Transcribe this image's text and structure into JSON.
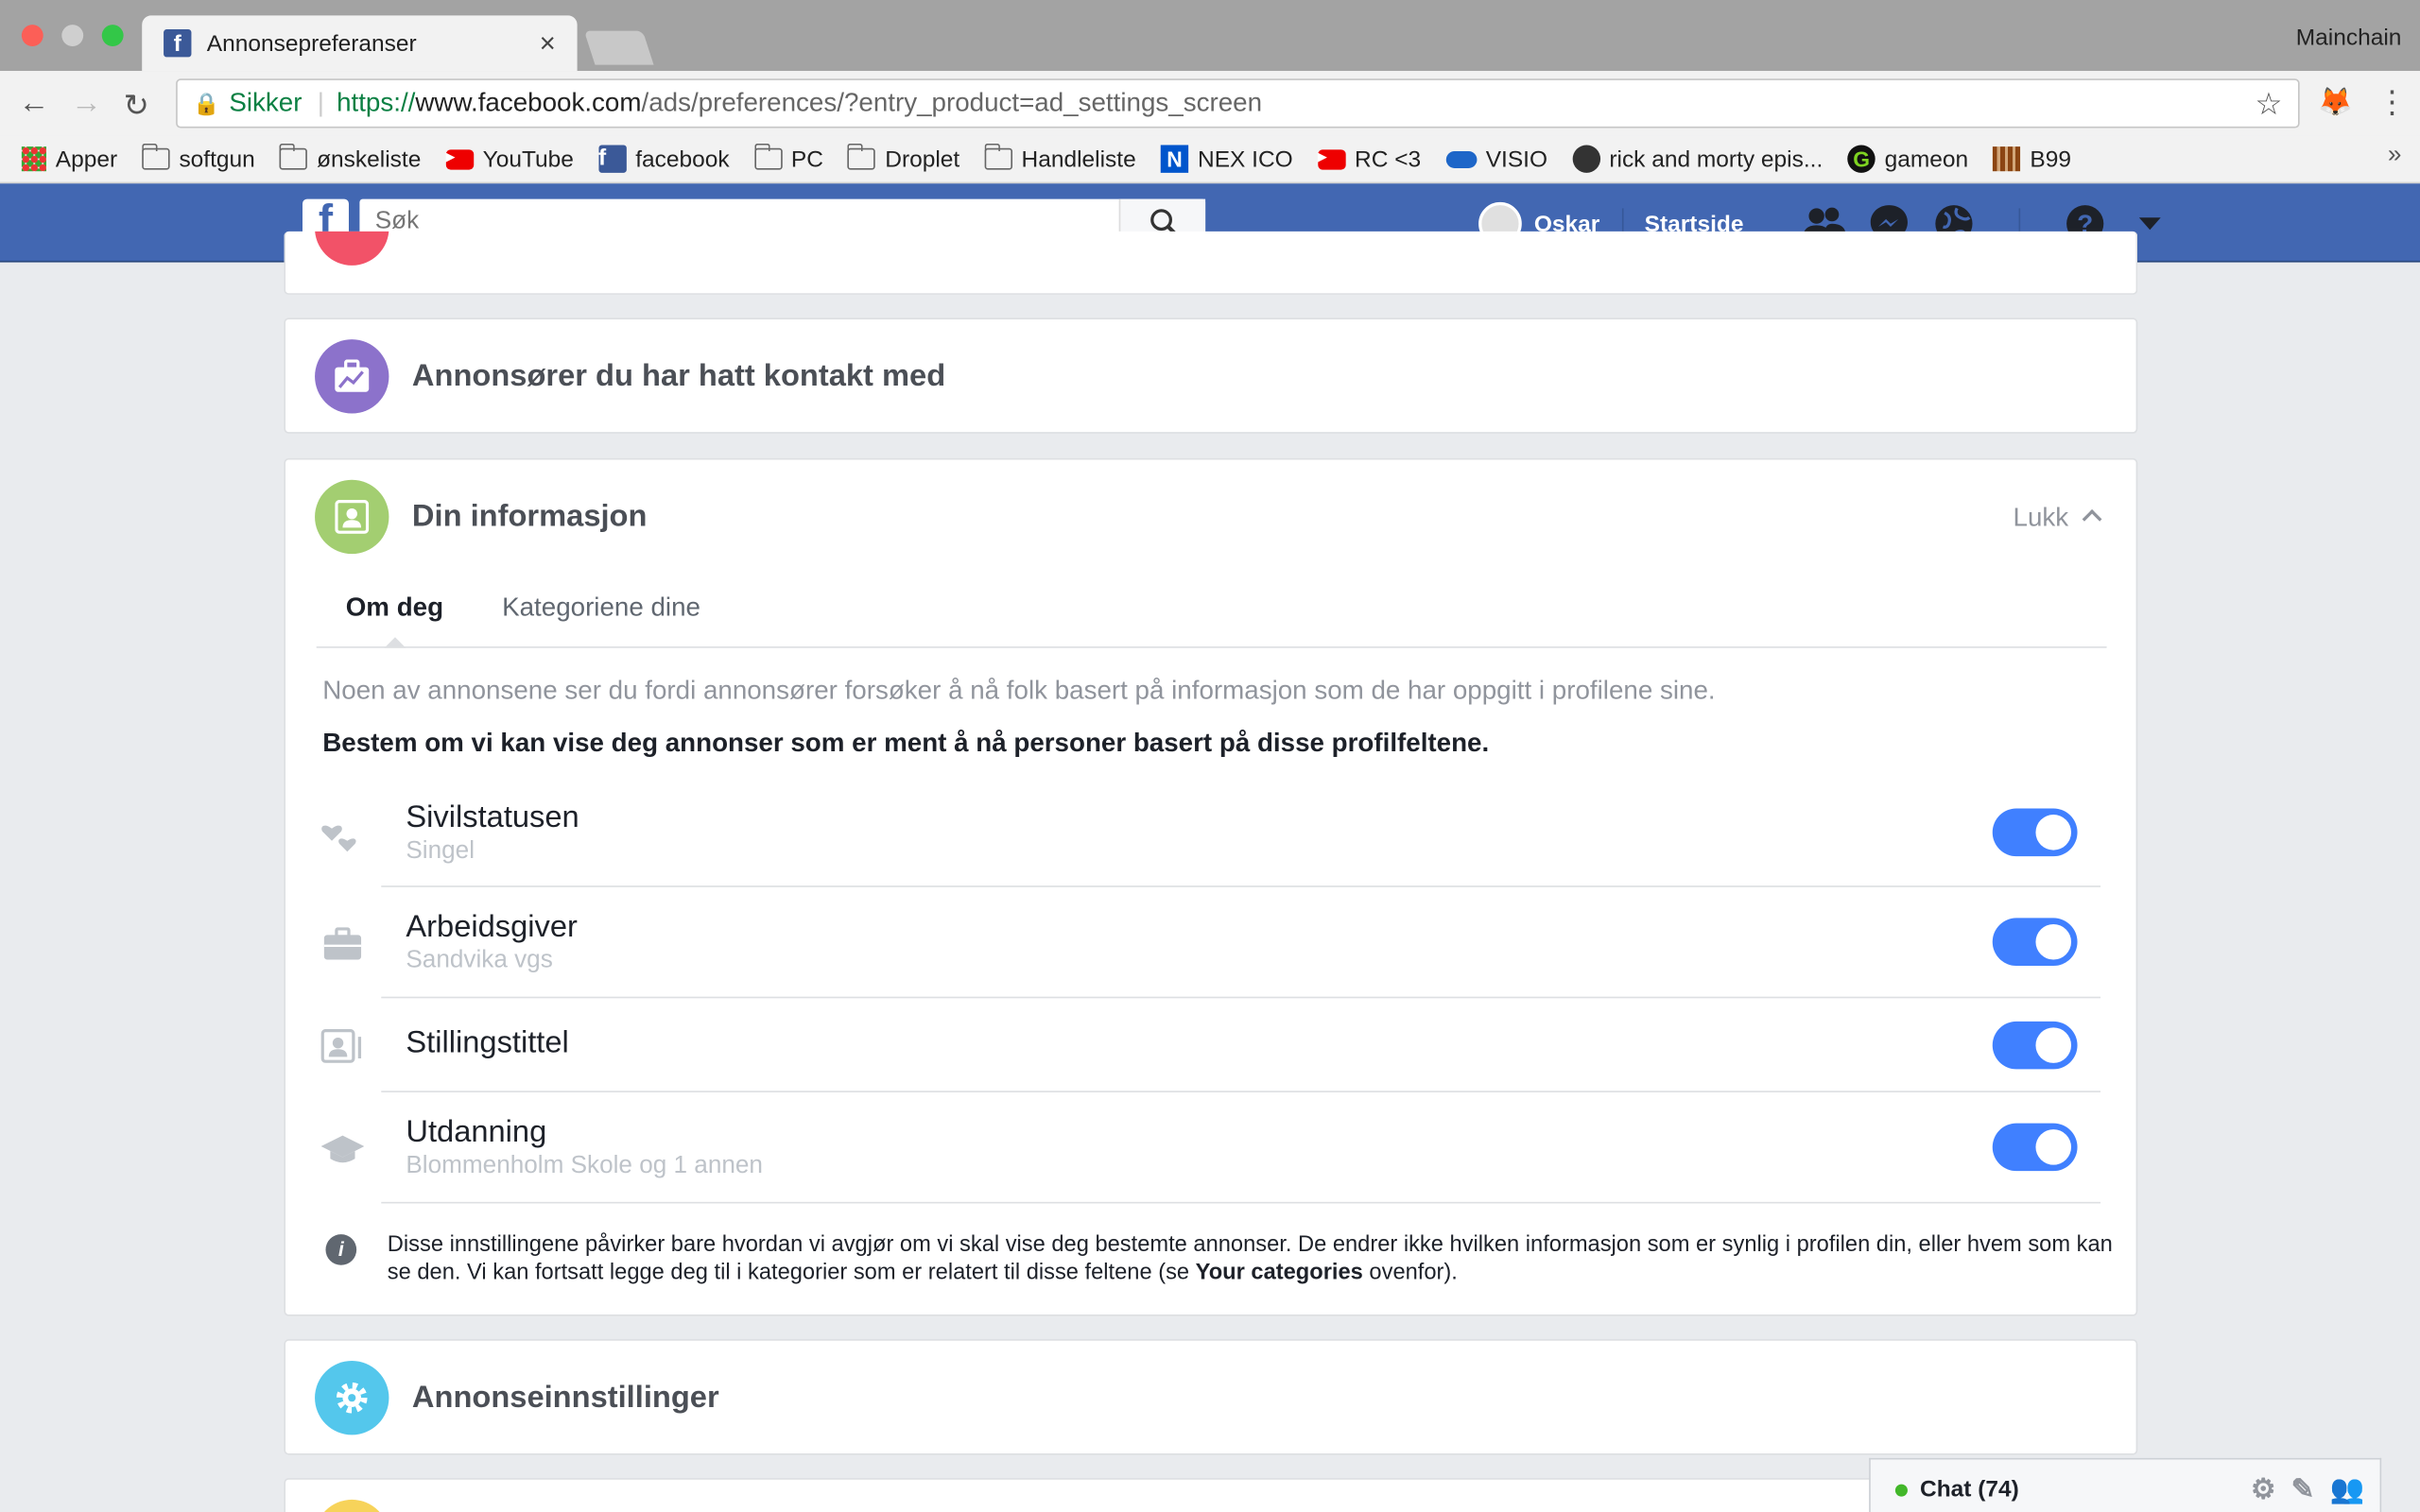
{
  "browser": {
    "tab_title": "Annonsepreferanser",
    "tab_close": "×",
    "profile_name": "Mainchain",
    "secure_label": "Sikker",
    "url_scheme": "https://",
    "url_host": "www.facebook.com",
    "url_path": "/ads/preferences/?entry_product=ad_settings_screen",
    "bookmarks": [
      "Apper",
      "softgun",
      "ønskeliste",
      "YouTube",
      "facebook",
      "PC",
      "Droplet",
      "Handleliste",
      "NEX ICO",
      "RC <3",
      "VISIO",
      "rick and morty epis...",
      "gameon",
      "B99"
    ],
    "bookmarks_more": "»"
  },
  "fb": {
    "search_placeholder": "Søk",
    "user_name": "Oskar",
    "home_label": "Startside"
  },
  "sections": {
    "advertisers_title": "Annonsører du har hatt kontakt med",
    "your_info_title": "Din informasjon",
    "close_label": "Lukk",
    "tabs": [
      "Om deg",
      "Kategoriene dine"
    ],
    "description": "Noen av annonsene ser du fordi annonsører forsøker å nå folk basert på informasjon som de har oppgitt i profilene sine.",
    "description_bold": "Bestem om vi kan vise deg annonser som er ment å nå personer basert på disse profilfeltene.",
    "rows": [
      {
        "label": "Sivilstatusen",
        "sub": "Singel",
        "enabled": true
      },
      {
        "label": "Arbeidsgiver",
        "sub": "Sandvika vgs",
        "enabled": true
      },
      {
        "label": "Stillingstittel",
        "sub": "",
        "enabled": true
      },
      {
        "label": "Utdanning",
        "sub": "Blommenholm Skole og 1 annen",
        "enabled": true
      }
    ],
    "info_text_1": "Disse innstillingene påvirker bare hvordan vi avgjør om vi skal vise deg bestemte annonser. De endrer ikke hvilken informasjon som er synlig i profilen din, eller hvem som kan se den. Vi kan fortsatt legge deg til i kategorier som er relatert til disse feltene (se ",
    "info_text_bold": "Your categories",
    "info_text_2": " ovenfor).",
    "ad_settings_title": "Annonseinnstillinger"
  },
  "chat": {
    "label": "Chat (74)"
  },
  "colors": {
    "fb_blue": "#4267b2",
    "toggle_on": "#4080ff",
    "purple": "#8c72cb",
    "green": "#a3ce71",
    "cyan": "#54c7ec"
  }
}
